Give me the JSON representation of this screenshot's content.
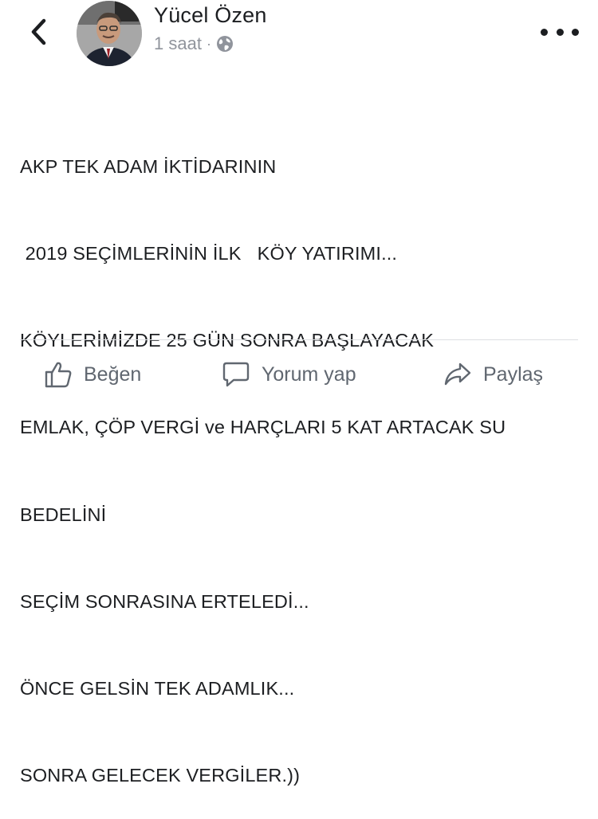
{
  "header": {
    "author_name": "Yücel Özen",
    "timestamp": "1 saat",
    "separator": "·",
    "privacy_icon": "globe-icon",
    "back_icon": "chevron-left-icon",
    "more_icon": "more-dots-icon"
  },
  "post": {
    "lines": [
      "AKP TEK ADAM İKTİDARININ",
      " 2019 SEÇİMLERİNİN İLK   KÖY YATIRIMI...",
      "KÖYLERİMİZDE 25 GÜN SONRA BAŞLAYACAK",
      "EMLAK, ÇÖP VERGİ ve HARÇLARI 5 KAT ARTACAK SU",
      "BEDELİNİ",
      "SEÇİM SONRASINA ERTELEDİ...",
      "ÖNCE GELSİN TEK ADAMLIK...",
      "SONRA GELECEK VERGİLER.))"
    ]
  },
  "actions": {
    "like_label": "Beğen",
    "comment_label": "Yorum yap",
    "share_label": "Paylaş",
    "like_icon": "thumbs-up-icon",
    "comment_icon": "comment-bubble-icon",
    "share_icon": "share-arrow-icon"
  },
  "colors": {
    "text": "#1c1e21",
    "meta": "#90949c",
    "action": "#606770",
    "divider": "#dddfe2"
  }
}
